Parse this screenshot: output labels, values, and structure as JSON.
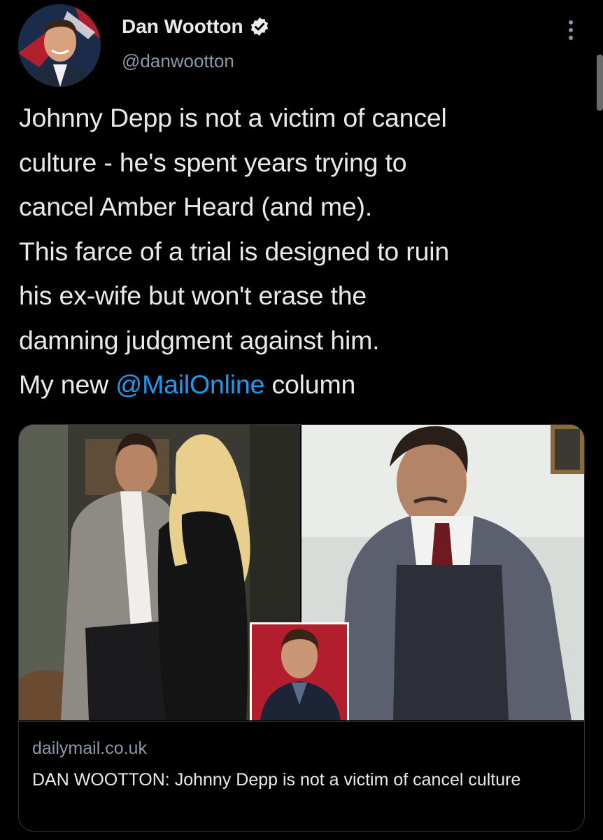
{
  "author": {
    "display_name": "Dan Wootton",
    "handle": "@danwootton",
    "verified": true,
    "avatar_icon": "profile-photo"
  },
  "tweet": {
    "lines": [
      "Johnny Depp is not a victim of cancel",
      "culture - he's spent years trying to",
      "cancel Amber Heard (and me).",
      "This farce of a trial is designed to ruin",
      "his ex-wife but won't erase the",
      "damning judgment against him."
    ],
    "last_line_prefix": "My new ",
    "mention": "@MailOnline",
    "last_line_suffix": " column"
  },
  "card": {
    "domain": "dailymail.co.uk",
    "title": "DAN WOOTTON: Johnny Depp is not a victim of cancel culture"
  },
  "colors": {
    "background": "#000000",
    "text": "#e7e9ea",
    "secondary_text": "#8b98a5",
    "link": "#1d9bf0",
    "border": "#2f3336"
  }
}
